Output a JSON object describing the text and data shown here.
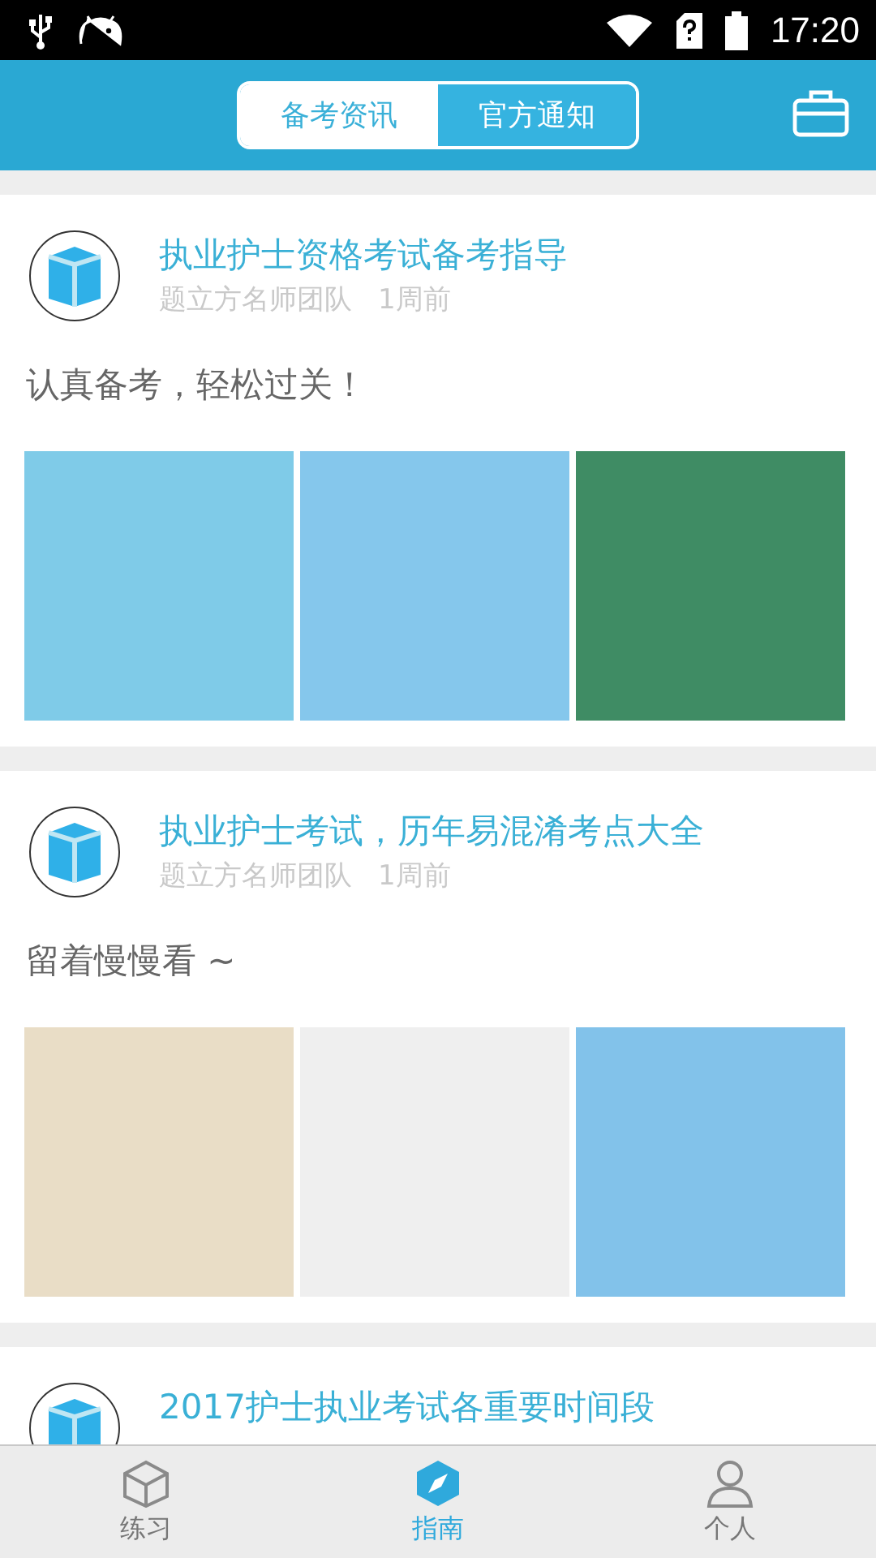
{
  "status_bar": {
    "time": "17:20"
  },
  "header": {
    "tabs": [
      {
        "label": "备考资讯",
        "selected": true
      },
      {
        "label": "官方通知",
        "selected": false
      }
    ]
  },
  "feed": [
    {
      "title": "执业护士资格考试备考指导",
      "author": "题立方名师团队",
      "time": "1周前",
      "summary": "认真备考，轻松过关！",
      "images": [
        {
          "kind": "cap"
        },
        {
          "kind": "nurse"
        },
        {
          "kind": "care"
        }
      ]
    },
    {
      "title": "执业护士考试，历年易混淆考点大全",
      "author": "题立方名师团队",
      "time": "1周前",
      "summary": "留着慢慢看 ~",
      "images": [
        {
          "kind": "hands"
        },
        {
          "kind": "stack"
        },
        {
          "kind": "book"
        }
      ]
    },
    {
      "title": "2017护士执业考试各重要时间段"
    }
  ],
  "bottom_nav": [
    {
      "label": "练习",
      "selected": false
    },
    {
      "label": "指南",
      "selected": true
    },
    {
      "label": "个人",
      "selected": false
    }
  ]
}
